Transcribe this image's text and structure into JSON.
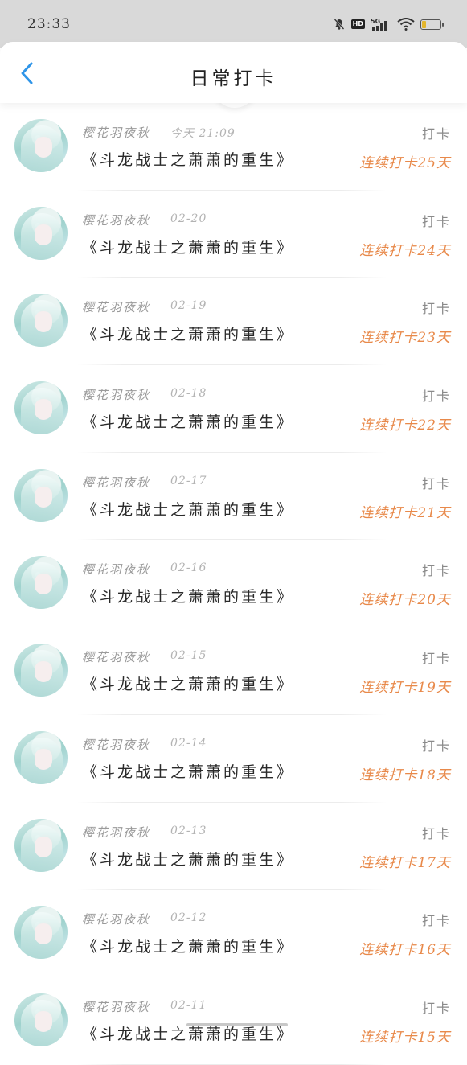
{
  "status_bar": {
    "time": "23:33",
    "icons": [
      "mute-bell-icon",
      "hd-icon",
      "5g-signal-icon",
      "wifi-icon",
      "battery-icon"
    ],
    "network": "5G",
    "hd": "HD",
    "battery_level": 0.25
  },
  "header": {
    "title": "日常打卡",
    "back_icon": "chevron-left-icon",
    "accent_color": "#2f95e8"
  },
  "colors": {
    "streak": "#e8894a",
    "status_bar_bg": "#d9d9d9"
  },
  "checkins": [
    {
      "username": "樱花羽夜秋",
      "date": "今天 21:09",
      "book": "《斗龙战士之萧萧的重生》",
      "label": "打卡",
      "streak": "连续打卡25天"
    },
    {
      "username": "樱花羽夜秋",
      "date": "02-20",
      "book": "《斗龙战士之萧萧的重生》",
      "label": "打卡",
      "streak": "连续打卡24天"
    },
    {
      "username": "樱花羽夜秋",
      "date": "02-19",
      "book": "《斗龙战士之萧萧的重生》",
      "label": "打卡",
      "streak": "连续打卡23天"
    },
    {
      "username": "樱花羽夜秋",
      "date": "02-18",
      "book": "《斗龙战士之萧萧的重生》",
      "label": "打卡",
      "streak": "连续打卡22天"
    },
    {
      "username": "樱花羽夜秋",
      "date": "02-17",
      "book": "《斗龙战士之萧萧的重生》",
      "label": "打卡",
      "streak": "连续打卡21天"
    },
    {
      "username": "樱花羽夜秋",
      "date": "02-16",
      "book": "《斗龙战士之萧萧的重生》",
      "label": "打卡",
      "streak": "连续打卡20天"
    },
    {
      "username": "樱花羽夜秋",
      "date": "02-15",
      "book": "《斗龙战士之萧萧的重生》",
      "label": "打卡",
      "streak": "连续打卡19天"
    },
    {
      "username": "樱花羽夜秋",
      "date": "02-14",
      "book": "《斗龙战士之萧萧的重生》",
      "label": "打卡",
      "streak": "连续打卡18天"
    },
    {
      "username": "樱花羽夜秋",
      "date": "02-13",
      "book": "《斗龙战士之萧萧的重生》",
      "label": "打卡",
      "streak": "连续打卡17天"
    },
    {
      "username": "樱花羽夜秋",
      "date": "02-12",
      "book": "《斗龙战士之萧萧的重生》",
      "label": "打卡",
      "streak": "连续打卡16天"
    },
    {
      "username": "樱花羽夜秋",
      "date": "02-11",
      "book": "《斗龙战士之萧萧的重生》",
      "label": "打卡",
      "streak": "连续打卡15天"
    }
  ]
}
